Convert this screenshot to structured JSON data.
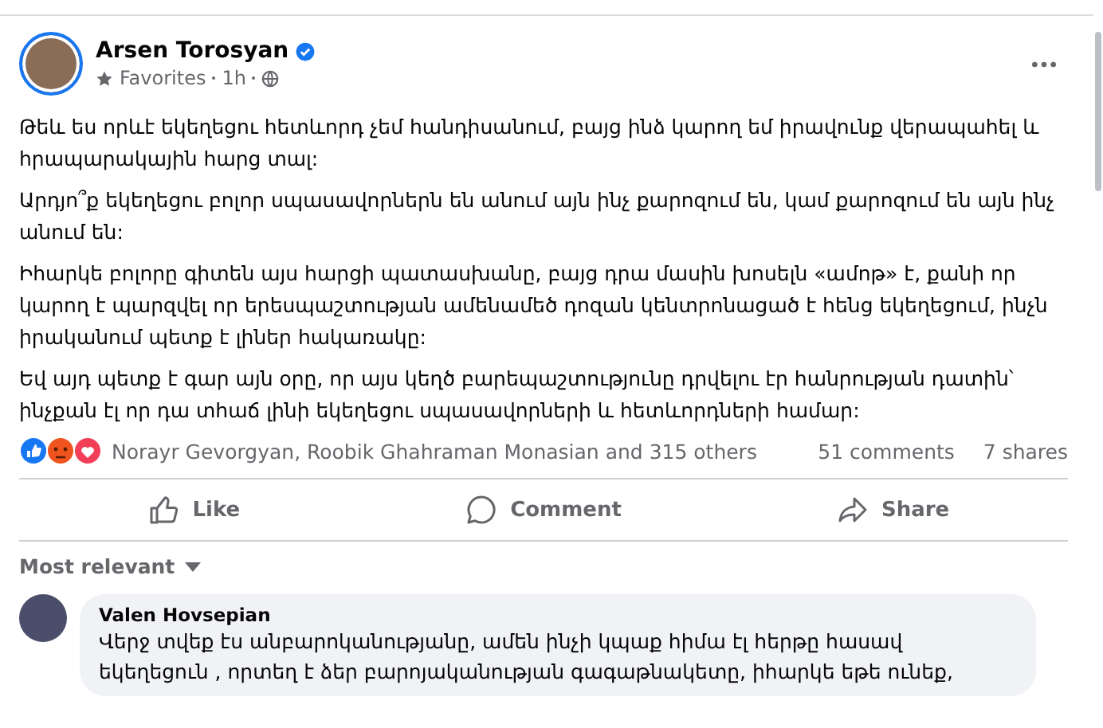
{
  "post": {
    "author": "Arsen Torosyan",
    "verified": true,
    "audience": "Favorites",
    "time": "1h",
    "paragraphs": [
      "Թեև ես որևէ եկեղեցու հետևորդ չեմ հանդիսանում, բայց ինձ կարող եմ իրավունք վերապահել և հրապարակային հարց տալ:",
      "Արդյո՞ք եկեղեցու բոլոր սպասավորներն են անում այն ինչ քարոզում են, կամ քարոզում են այն ինչ անում են:",
      "Իհարկե բոլորը գիտեն այս հարցի պատասխանը, բայց դրա մասին խոսելն «ամոթ» է, քանի որ կարող է պարզվել որ երեսպաշտության ամենամեծ դոզան կենտրոնացած է հենց եկեղեցում, ինչն իրականում պետք է լիներ հակառակը:",
      "Եվ այդ պետք է գար այն օրը, որ այս կեղծ բարեպաշտությունը դրվելու էր հանրության դատին՝ ինչքան էլ որ դա տհաճ լինի եկեղեցու սպասավորների և հետևորդների համար:"
    ]
  },
  "reactions": {
    "names": "Norayr Gevorgyan, Roobik Ghahraman Monasian and 315 others",
    "comments": "51 comments",
    "shares": "7 shares"
  },
  "actions": [
    "Like",
    "Comment",
    "Share"
  ],
  "sort": "Most relevant",
  "comments": [
    {
      "author": "Valen Hovsepian",
      "text": "Վերջ տվեք էս անբարոկանությանը, ամեն ինչի կպաք հիմա էլ հերթը հասավ եկեղեցուն , որտեղ է ձեր բարոյականության գագաթնակետը, իհարկե եթե ունեք,"
    }
  ]
}
